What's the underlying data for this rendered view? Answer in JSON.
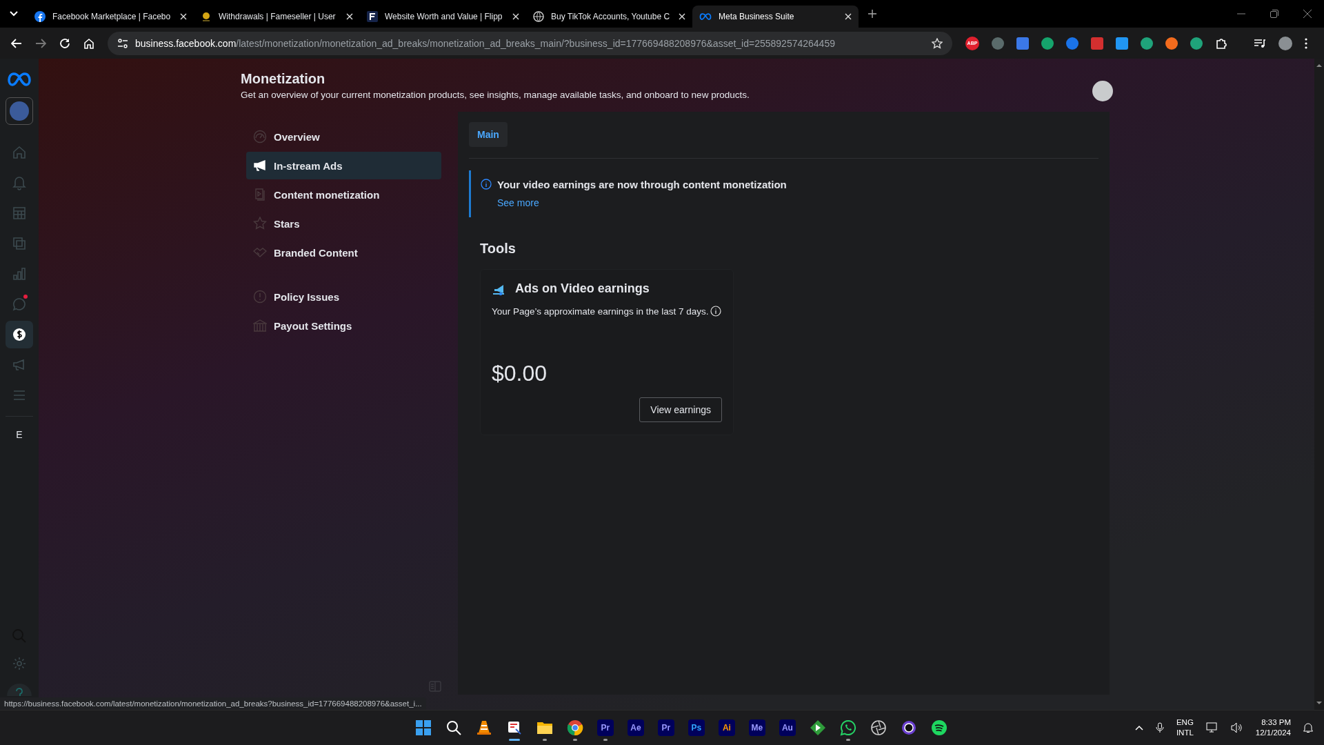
{
  "browser": {
    "tabs": [
      {
        "title": "Facebook Marketplace | Facebo",
        "kind": "facebook",
        "selected": false
      },
      {
        "title": "Withdrawals | Fameseller | User",
        "kind": "coin",
        "selected": false
      },
      {
        "title": "Website Worth and Value | Flipp",
        "kind": "letter",
        "selected": false
      },
      {
        "title": "Buy TikTok Accounts, Youtube C",
        "kind": "globe",
        "selected": false
      },
      {
        "title": "Meta Business Suite",
        "kind": "meta",
        "selected": true
      }
    ],
    "url": {
      "host": "business.facebook.com",
      "path": "/latest/monetization/monetization_ad_breaks/monetization_ad_breaks_main/?business_id=177669488208976&asset_id=255892574264459"
    },
    "extensions": [
      {
        "kind": "text",
        "label": "ABP",
        "color": "#e0202e"
      },
      {
        "kind": "round",
        "color": "#5a6b6b"
      },
      {
        "kind": "square",
        "color": "#3b78e7"
      },
      {
        "kind": "round",
        "color": "#15a46c"
      },
      {
        "kind": "round",
        "color": "#1a73e8"
      },
      {
        "kind": "square",
        "color": "#d32f2f"
      },
      {
        "kind": "square",
        "color": "#2196f3"
      },
      {
        "kind": "round",
        "color": "#1fa37a"
      },
      {
        "kind": "round",
        "color": "#f26b1d"
      },
      {
        "kind": "round",
        "color": "#1fa37a"
      }
    ]
  },
  "rail": {
    "items": [
      {
        "kind": "home",
        "selected": false,
        "badge": false
      },
      {
        "kind": "bell",
        "selected": false,
        "badge": false
      },
      {
        "kind": "table",
        "selected": false,
        "badge": false
      },
      {
        "kind": "pages",
        "selected": false,
        "badge": false
      },
      {
        "kind": "chart",
        "selected": false,
        "badge": false
      },
      {
        "kind": "chat",
        "selected": false,
        "badge": true
      },
      {
        "kind": "dollar",
        "selected": true,
        "badge": false
      },
      {
        "kind": "megaphone",
        "selected": false,
        "badge": false
      },
      {
        "kind": "menu",
        "selected": false,
        "badge": false
      }
    ],
    "letter": "E"
  },
  "header": {
    "title": "Monetization",
    "subtitle": "Get an overview of your current monetization products, see insights, manage available tasks, and onboard to new products."
  },
  "nav": {
    "groups": [
      [
        {
          "label": "Overview",
          "kind": "gauge",
          "selected": false
        },
        {
          "label": "In-stream Ads",
          "kind": "megaphone",
          "selected": true
        },
        {
          "label": "Content monetization",
          "kind": "video",
          "selected": false
        },
        {
          "label": "Stars",
          "kind": "star",
          "selected": false
        },
        {
          "label": "Branded Content",
          "kind": "handshake",
          "selected": false
        }
      ],
      [
        {
          "label": "Policy Issues",
          "kind": "alert",
          "selected": false
        },
        {
          "label": "Payout Settings",
          "kind": "bank",
          "selected": false
        }
      ]
    ]
  },
  "panel": {
    "tabs": [
      {
        "label": "Main",
        "selected": true
      }
    ],
    "notice": {
      "text": "Your video earnings are now through content monetization",
      "link": "See more"
    },
    "tools_heading": "Tools",
    "card": {
      "title": "Ads on Video earnings",
      "description": "Your Page’s approximate earnings in the last 7 days.",
      "amount": "$0.00",
      "button": "View earnings"
    }
  },
  "status_url": "https://business.facebook.com/latest/monetization/monetization_ad_breaks?business_id=177669488208976&asset_i...",
  "taskbar": {
    "apps": [
      {
        "kind": "windows",
        "running": false
      },
      {
        "kind": "search",
        "running": false
      },
      {
        "kind": "cone",
        "running": false
      },
      {
        "kind": "snip",
        "running": true
      },
      {
        "kind": "folder",
        "running": true
      },
      {
        "kind": "chrome",
        "running": true
      },
      {
        "kind": "adobe",
        "label": "Pr",
        "color": "#9999ff",
        "running": true
      },
      {
        "kind": "adobe",
        "label": "Ae",
        "color": "#9999ff",
        "running": false
      },
      {
        "kind": "adobe",
        "label": "Pr",
        "color": "#9999ff",
        "running": false
      },
      {
        "kind": "adobe",
        "label": "Ps",
        "color": "#31a8ff",
        "running": false
      },
      {
        "kind": "adobe",
        "label": "Ai",
        "color": "#ff9a00",
        "running": false
      },
      {
        "kind": "adobe",
        "label": "Me",
        "color": "#9999ff",
        "running": false
      },
      {
        "kind": "adobe",
        "label": "Au",
        "color": "#9999ff",
        "running": false
      },
      {
        "kind": "play",
        "running": false
      },
      {
        "kind": "whatsapp",
        "running": true
      },
      {
        "kind": "aperture",
        "running": false
      },
      {
        "kind": "ring",
        "running": false
      },
      {
        "kind": "spotify",
        "running": false
      }
    ],
    "lang": "ENG",
    "layout": "INTL",
    "time": "8:33 PM",
    "date": "12/1/2024"
  }
}
